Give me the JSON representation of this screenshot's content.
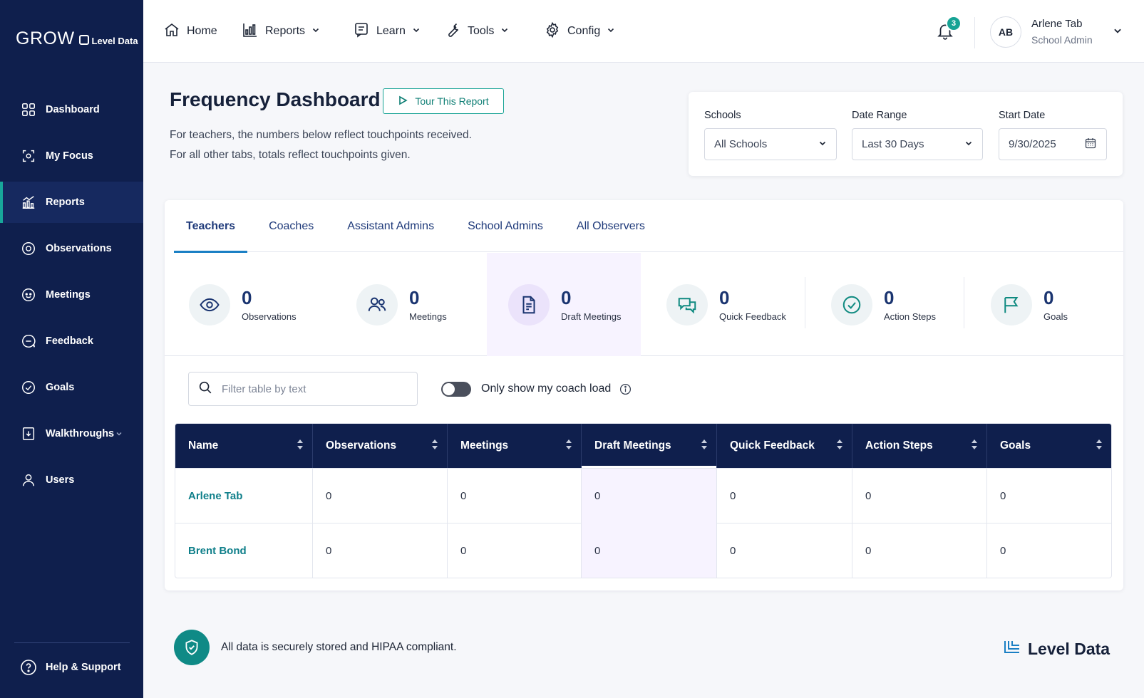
{
  "brand": {
    "product": "GROW",
    "company": "Level Data"
  },
  "sidebar": {
    "items": [
      {
        "label": "Dashboard",
        "icon": "dashboard-icon"
      },
      {
        "label": "My Focus",
        "icon": "focus-icon"
      },
      {
        "label": "Reports",
        "icon": "reports-icon",
        "active": true
      },
      {
        "label": "Observations",
        "icon": "observations-icon"
      },
      {
        "label": "Meetings",
        "icon": "meetings-icon"
      },
      {
        "label": "Feedback",
        "icon": "feedback-icon"
      },
      {
        "label": "Goals",
        "icon": "goals-icon"
      },
      {
        "label": "Walkthroughs",
        "icon": "walkthroughs-icon",
        "has_submenu": true
      },
      {
        "label": "Users",
        "icon": "users-icon"
      }
    ],
    "help_label": "Help & Support"
  },
  "topnav": {
    "items": [
      {
        "label": "Home",
        "icon": "home-icon",
        "dropdown": false
      },
      {
        "label": "Reports",
        "icon": "chart-icon",
        "dropdown": true
      },
      {
        "label": "Learn",
        "icon": "learn-icon",
        "dropdown": true
      },
      {
        "label": "Tools",
        "icon": "wrench-icon",
        "dropdown": true
      },
      {
        "label": "Config",
        "icon": "gear-icon",
        "dropdown": true
      }
    ],
    "notification_count": "3",
    "user": {
      "initials": "AB",
      "name": "Arlene Tab",
      "role": "School Admin"
    }
  },
  "page": {
    "title": "Frequency Dashboard",
    "tour_button": "Tour This Report",
    "description_line1": "For teachers, the numbers below reflect touchpoints received.",
    "description_line2": "For all other tabs, totals reflect touchpoints given."
  },
  "filters": {
    "schools": {
      "label": "Schools",
      "value": "All Schools"
    },
    "date_range": {
      "label": "Date Range",
      "value": "Last 30 Days"
    },
    "start_date": {
      "label": "Start Date",
      "value": "9/30/2025"
    }
  },
  "tabs": [
    {
      "label": "Teachers",
      "active": true
    },
    {
      "label": "Coaches"
    },
    {
      "label": "Assistant Admins"
    },
    {
      "label": "School Admins"
    },
    {
      "label": "All Observers"
    }
  ],
  "stats": [
    {
      "value": "0",
      "label": "Observations",
      "icon": "eye-icon"
    },
    {
      "value": "0",
      "label": "Meetings",
      "icon": "people-icon"
    },
    {
      "value": "0",
      "label": "Draft Meetings",
      "icon": "document-icon",
      "highlight": true
    },
    {
      "value": "0",
      "label": "Quick Feedback",
      "icon": "chat-icon"
    },
    {
      "value": "0",
      "label": "Action Steps",
      "icon": "check-circle-icon"
    },
    {
      "value": "0",
      "label": "Goals",
      "icon": "flag-icon"
    }
  ],
  "table_controls": {
    "filter_placeholder": "Filter table by text",
    "toggle_label": "Only show my coach load",
    "toggle_on": false
  },
  "table": {
    "columns": [
      "Name",
      "Observations",
      "Meetings",
      "Draft Meetings",
      "Quick Feedback",
      "Action Steps",
      "Goals"
    ],
    "rows": [
      [
        "Arlene Tab",
        "0",
        "0",
        "0",
        "0",
        "0",
        "0"
      ],
      [
        "Brent Bond",
        "0",
        "0",
        "0",
        "0",
        "0",
        "0"
      ]
    ]
  },
  "footer": {
    "security_text": "All data is securely stored and HIPAA compliant.",
    "logo_text": "Level Data"
  },
  "colors": {
    "navy": "#0f1f4d",
    "teal": "#17a395",
    "tab_blue": "#1f3a7a",
    "highlight": "#f7f3ff"
  }
}
